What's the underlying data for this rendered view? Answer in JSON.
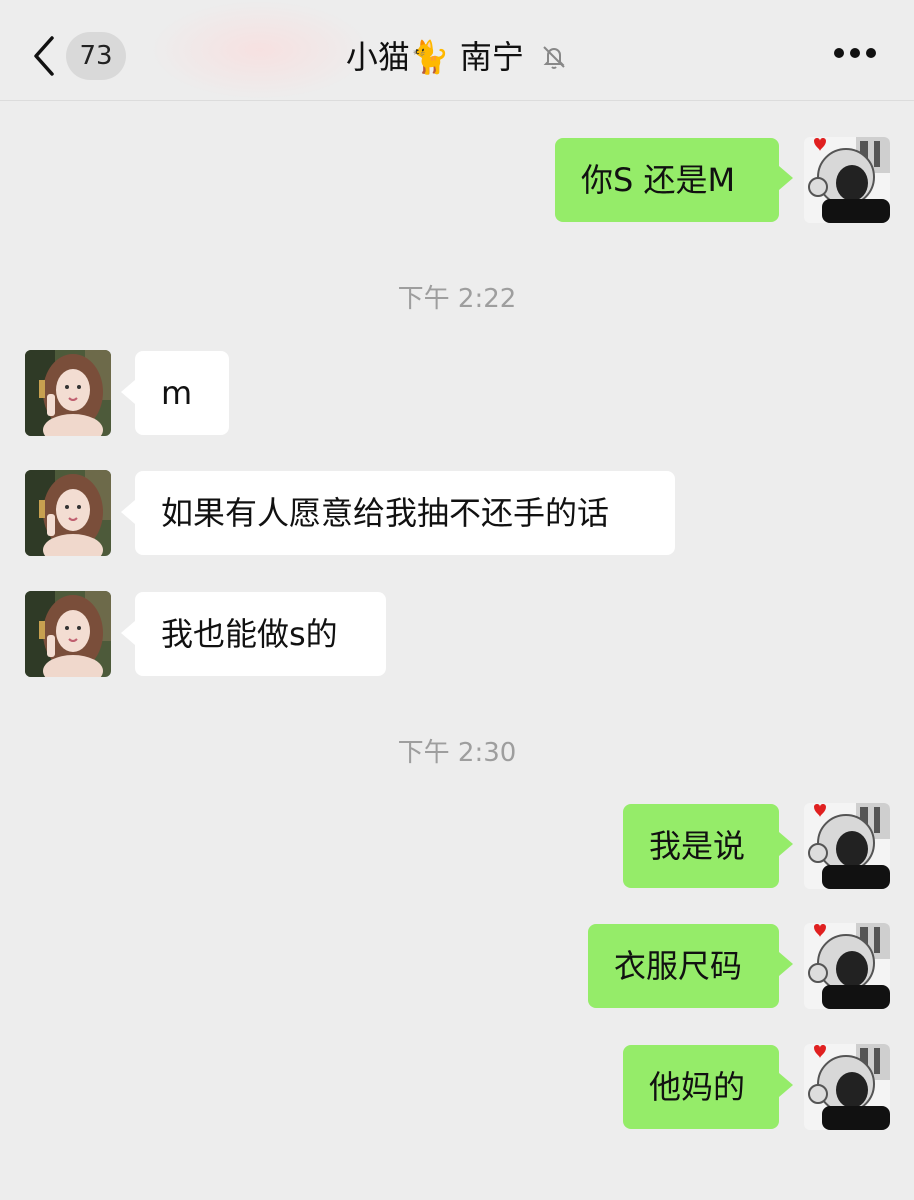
{
  "header": {
    "unread_count": "73",
    "title_prefix": "小猫",
    "title_emoji": "🐈",
    "title_suffix": "南宁"
  },
  "timestamps": [
    "下午 2:22",
    "下午 2:30"
  ],
  "messages": [
    {
      "side": "out",
      "text": "你S 还是M"
    },
    {
      "side": "in",
      "text": "m"
    },
    {
      "side": "in",
      "text": "如果有人愿意给我抽不还手的话"
    },
    {
      "side": "in",
      "text": "我也能做s的"
    },
    {
      "side": "out",
      "text": "我是说"
    },
    {
      "side": "out",
      "text": "衣服尺码"
    },
    {
      "side": "out",
      "text": "他妈的"
    }
  ],
  "colors": {
    "background": "#ededed",
    "outgoing_bubble": "#95ec69",
    "incoming_bubble": "#ffffff",
    "timestamp_text": "#9e9e9e"
  },
  "icons": {
    "back": "chevron-left-icon",
    "mute": "bell-slash-icon",
    "more": "more-dots-icon"
  }
}
